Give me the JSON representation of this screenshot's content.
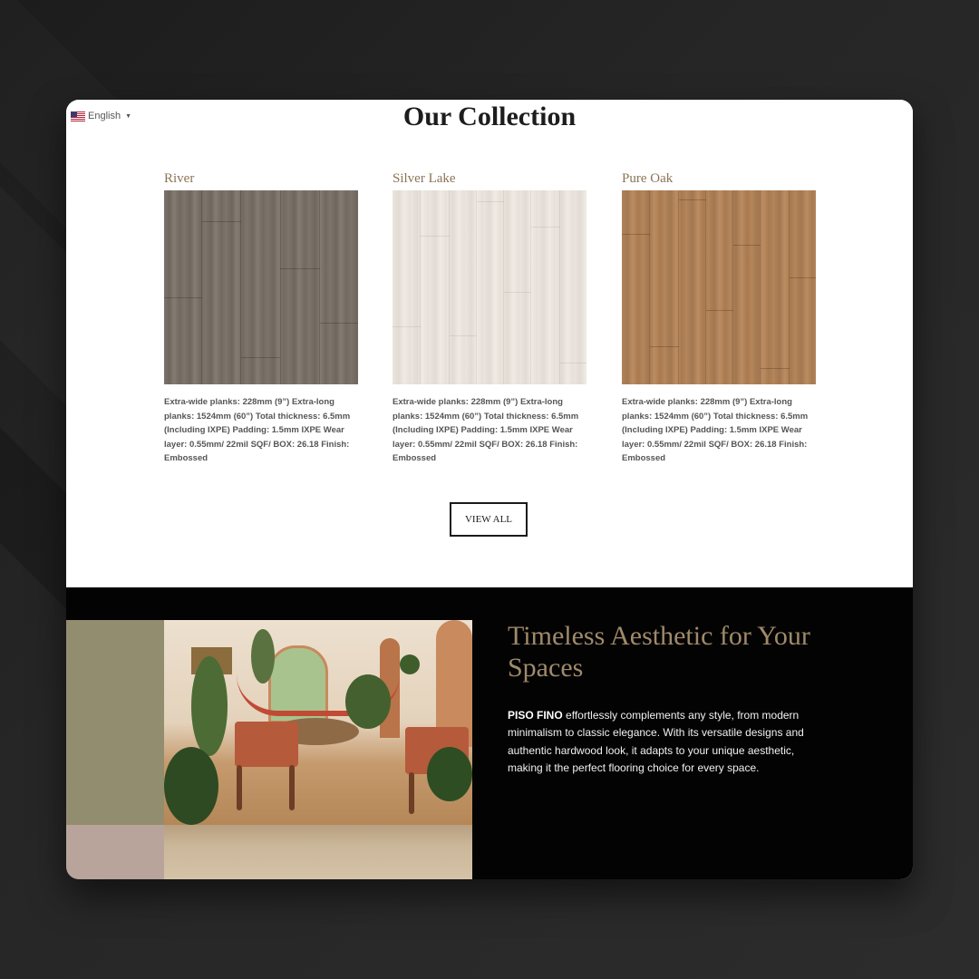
{
  "language": {
    "label": "English",
    "flag_icon": "us-flag-icon",
    "caret_icon": "caret-down-icon"
  },
  "collection": {
    "title": "Our Collection",
    "products": [
      {
        "name": "River",
        "swatch_color": "#766e65",
        "description": "Extra-wide planks: 228mm (9”) Extra-long planks: 1524mm (60”) Total thickness: 6.5mm (Including IXPE) Padding: 1.5mm IXPE Wear layer: 0.55mm/ 22mil SQF/ BOX: 26.18 Finish: Embossed"
      },
      {
        "name": "Silver Lake",
        "swatch_color": "#e8e2dc",
        "description": "Extra-wide planks: 228mm (9”) Extra-long planks: 1524mm (60”) Total thickness: 6.5mm (Including IXPE) Padding: 1.5mm IXPE Wear layer: 0.55mm/ 22mil SQF/ BOX: 26.18 Finish: Embossed"
      },
      {
        "name": "Pure Oak",
        "swatch_color": "#ad7f55",
        "description": "Extra-wide planks: 228mm (9”) Extra-long planks: 1524mm (60”) Total thickness: 6.5mm (Including IXPE) Padding: 1.5mm IXPE Wear layer: 0.55mm/ 22mil SQF/ BOX: 26.18 Finish: Embossed"
      }
    ],
    "view_all_label": "VIEW ALL"
  },
  "feature": {
    "heading": "Timeless Aesthetic for Your Spaces",
    "brand": "PISO FINO",
    "body": " effortlessly complements any style, from modern minimalism to classic elegance. With its versatile designs and authentic hardwood look, it adapts to your unique aesthetic, making it the perfect flooring choice for every space."
  },
  "colors": {
    "accent_gold": "#a08a6a",
    "product_name": "#8a7456",
    "dark_bg": "#030303",
    "olive_panel": "#938d6f",
    "pink_panel": "#b9a49b"
  }
}
